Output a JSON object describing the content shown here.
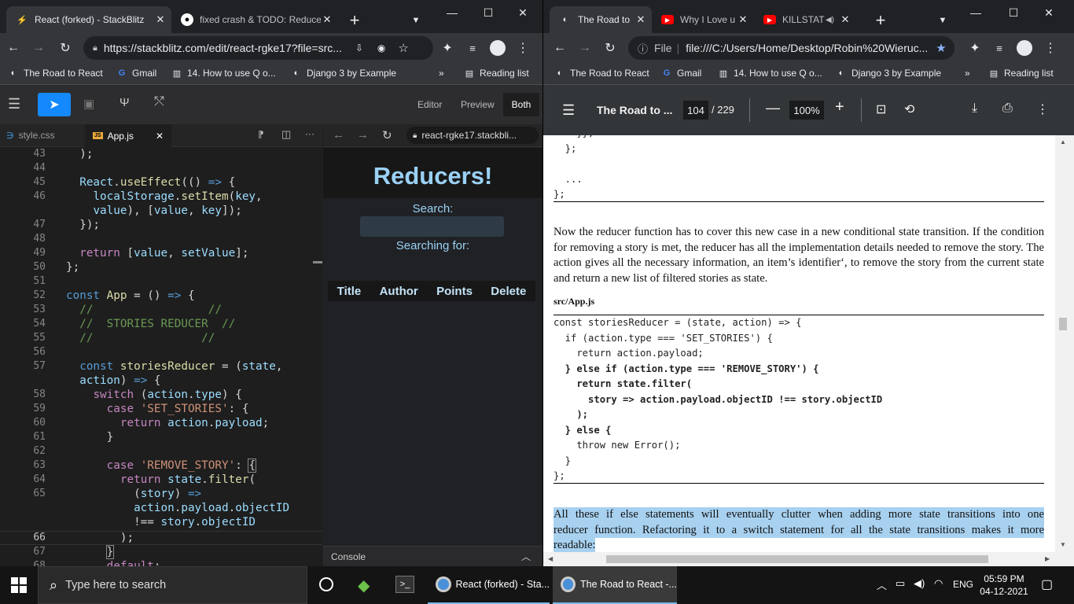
{
  "left_browser": {
    "tabs": [
      {
        "title": "React (forked) - StackBlitz",
        "active": true
      },
      {
        "title": "fixed crash & TODO: Reduce",
        "active": false
      }
    ],
    "url": "https://stackblitz.com/edit/react-rgke17?file=src...",
    "bookmarks": [
      "The Road to React",
      "Gmail",
      "14. How to use Q o...",
      "Django 3 by Example"
    ],
    "reading_list": "Reading list"
  },
  "stackblitz": {
    "view_modes": [
      "Editor",
      "Preview",
      "Both"
    ],
    "active_view": "Both",
    "file_tabs": [
      "style.css",
      "App.js"
    ],
    "active_file": "App.js",
    "preview_url": "react-rgke17.stackbli...",
    "preview": {
      "heading": "Reducers!",
      "search_label": "Search:",
      "searching_for": "Searching for:",
      "columns": [
        "Title",
        "Author",
        "Points",
        "Delete"
      ]
    },
    "console_label": "Console",
    "current_line": "66"
  },
  "right_browser": {
    "tabs": [
      {
        "title": "The Road to",
        "active": true
      },
      {
        "title": "Why I Love u",
        "active": false
      },
      {
        "title": "KILLSTAT",
        "active": false
      }
    ],
    "url_prefix": "File",
    "url": "file:///C:/Users/Home/Desktop/Robin%20Wieruc...",
    "bookmarks": [
      "The Road to React",
      "Gmail",
      "14. How to use Q o...",
      "Django 3 by Example"
    ],
    "reading_list": "Reading list"
  },
  "pdf_viewer": {
    "title": "The Road to ...",
    "page": "104",
    "page_total": "/ 229",
    "zoom": "100%",
    "code_top": [
      "    }};",
      "  };",
      "",
      "  ...",
      "};"
    ],
    "paragraph1": "Now the reducer function has to cover this new case in a new conditional state transition. If the condition for removing a story is met, the reducer has all the implementation details needed to remove the story. The action gives all the necessary information, an item’s identifier‘, to remove the story from the current state and return a new list of filtered stories as state.",
    "file_label": "src/App.js",
    "code_block": [
      {
        "text": "const storiesReducer = (state, action) => {",
        "bold": false
      },
      {
        "text": "  if (action.type === 'SET_STORIES') {",
        "bold": false
      },
      {
        "text": "    return action.payload;",
        "bold": false
      },
      {
        "text": "  } else if (action.type === 'REMOVE_STORY') {",
        "bold": true
      },
      {
        "text": "    return state.filter(",
        "bold": true
      },
      {
        "text": "      story => action.payload.objectID !== story.objectID",
        "bold": true
      },
      {
        "text": "    );",
        "bold": true
      },
      {
        "text": "  } else {",
        "bold": true
      },
      {
        "text": "    throw new Error();",
        "bold": false
      },
      {
        "text": "  }",
        "bold": false
      },
      {
        "text": "};",
        "bold": false
      }
    ],
    "paragraph2_lines": [
      "All these if else statements will eventually clutter when adding more state transitions into one",
      "reducer function. Refactoring it to a switch statement for all the state transitions makes it more",
      "readable:"
    ]
  },
  "taskbar": {
    "search_placeholder": "Type here to search",
    "apps": [
      "React (forked) - Sta...",
      "The Road to React -..."
    ],
    "lang": "ENG",
    "time": "05:59 PM",
    "date": "04-12-2021"
  }
}
